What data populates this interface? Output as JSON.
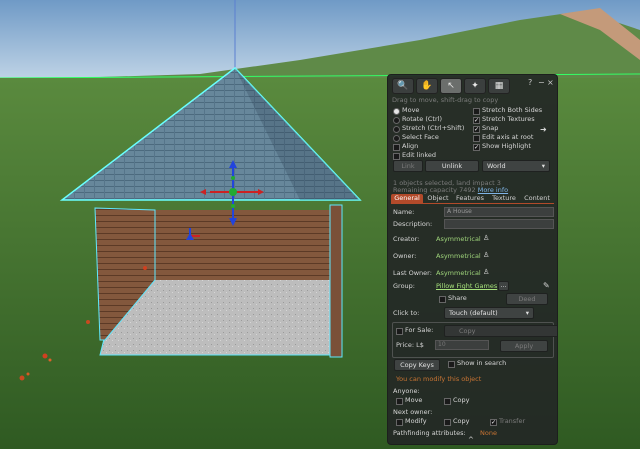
{
  "colors": {
    "sky": "#8fb5d8",
    "grass": "#3f6f2e",
    "roof": "#5f7f95",
    "wall": "#7a5038",
    "floor": "#b9b9b9",
    "highlight": "#66ffff",
    "panel_bg": "#262a28",
    "tab_accent": "#b24a2a",
    "name_green": "#9ed47a",
    "link_blue": "#7fb4e6",
    "section_orange": "#c97433"
  },
  "toolbar": {
    "icons": [
      "magnifier-icon",
      "hand-icon",
      "arrow-cursor-icon",
      "wrench-tools-icon",
      "land-icon"
    ],
    "help": "?",
    "minimize": "−",
    "close": "×"
  },
  "hint": "Drag to move, shift-drag to copy",
  "modes": {
    "left": [
      {
        "label": "Move",
        "selected": true
      },
      {
        "label": "Rotate (Ctrl)",
        "selected": false
      },
      {
        "label": "Stretch (Ctrl+Shift)",
        "selected": false
      },
      {
        "label": "Select Face",
        "selected": false
      }
    ],
    "align": "Align",
    "edit_linked": "Edit linked"
  },
  "options": [
    {
      "label": "Stretch Both Sides",
      "checked": false
    },
    {
      "label": "Stretch Textures",
      "checked": true
    },
    {
      "label": "Snap",
      "checked": true
    },
    {
      "label": "Edit axis at root",
      "checked": false
    },
    {
      "label": "Show Highlight",
      "checked": true
    }
  ],
  "link_btn": "Link",
  "unlink_btn": "Unlink",
  "world_select": "World",
  "status_line1": "1 objects selected, land impact 3",
  "status_line2_prefix": "Remaining capacity 7492",
  "more_info": "More info",
  "tabs": [
    "General",
    "Object",
    "Features",
    "Texture",
    "Content"
  ],
  "form": {
    "name_label": "Name:",
    "name_value": "A House",
    "desc_label": "Description:",
    "desc_value": "",
    "creator_label": "Creator:",
    "creator_value": "Asymmetrical",
    "owner_label": "Owner:",
    "owner_value": "Asymmetrical",
    "last_owner_label": "Last Owner:",
    "last_owner_value": "Asymmetrical",
    "group_label": "Group:",
    "group_value": "Pillow Fight Games",
    "group_btn": "...",
    "share_label": "Share",
    "deed_btn": "Deed",
    "click_label": "Click to:",
    "click_value": "Touch  (default)",
    "for_sale_label": "For Sale:",
    "for_sale_select": "Copy",
    "price_label": "Price: L$",
    "price_value": "10",
    "apply_btn": "Apply",
    "copy_keys_btn": "Copy Keys",
    "show_search": "Show in search",
    "modify_note": "You can modify this object",
    "anyone_label": "Anyone:",
    "anyone_move": "Move",
    "anyone_copy": "Copy",
    "next_owner_label": "Next owner:",
    "next_modify": "Modify",
    "next_copy": "Copy",
    "next_transfer": "Transfer",
    "pathfinding_label": "Pathfinding attributes:",
    "pathfinding_value": "None"
  },
  "collapse_icon": "^"
}
